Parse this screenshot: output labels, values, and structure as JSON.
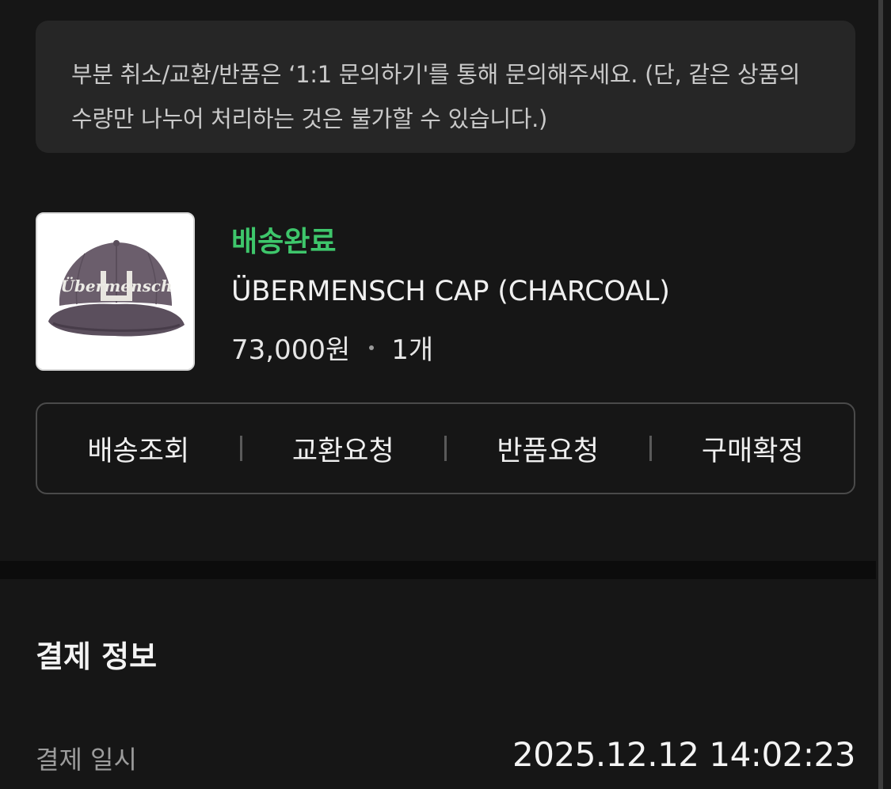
{
  "notice": {
    "text": "부분 취소/교환/반품은 ‘1:1 문의하기'를 통해 문의해주세요. (단, 같은 상품의 수량만 나누어 처리하는 것은 불가할 수 있습니다.)"
  },
  "order_item": {
    "image_icon": "cap-product-image",
    "image_text": "Übermensch",
    "status": "배송완료",
    "status_color": "#3ec66b",
    "product_name": "ÜBERMENSCH CAP (CHARCOAL)",
    "price": "73,000원",
    "quantity": "1개"
  },
  "actions": [
    {
      "label": "배송조회"
    },
    {
      "label": "교환요청"
    },
    {
      "label": "반품요청"
    },
    {
      "label": "구매확정"
    }
  ],
  "payment": {
    "title": "결제 정보",
    "date_label": "결제 일시",
    "date_value": "2025.12.12 14:02:23"
  }
}
